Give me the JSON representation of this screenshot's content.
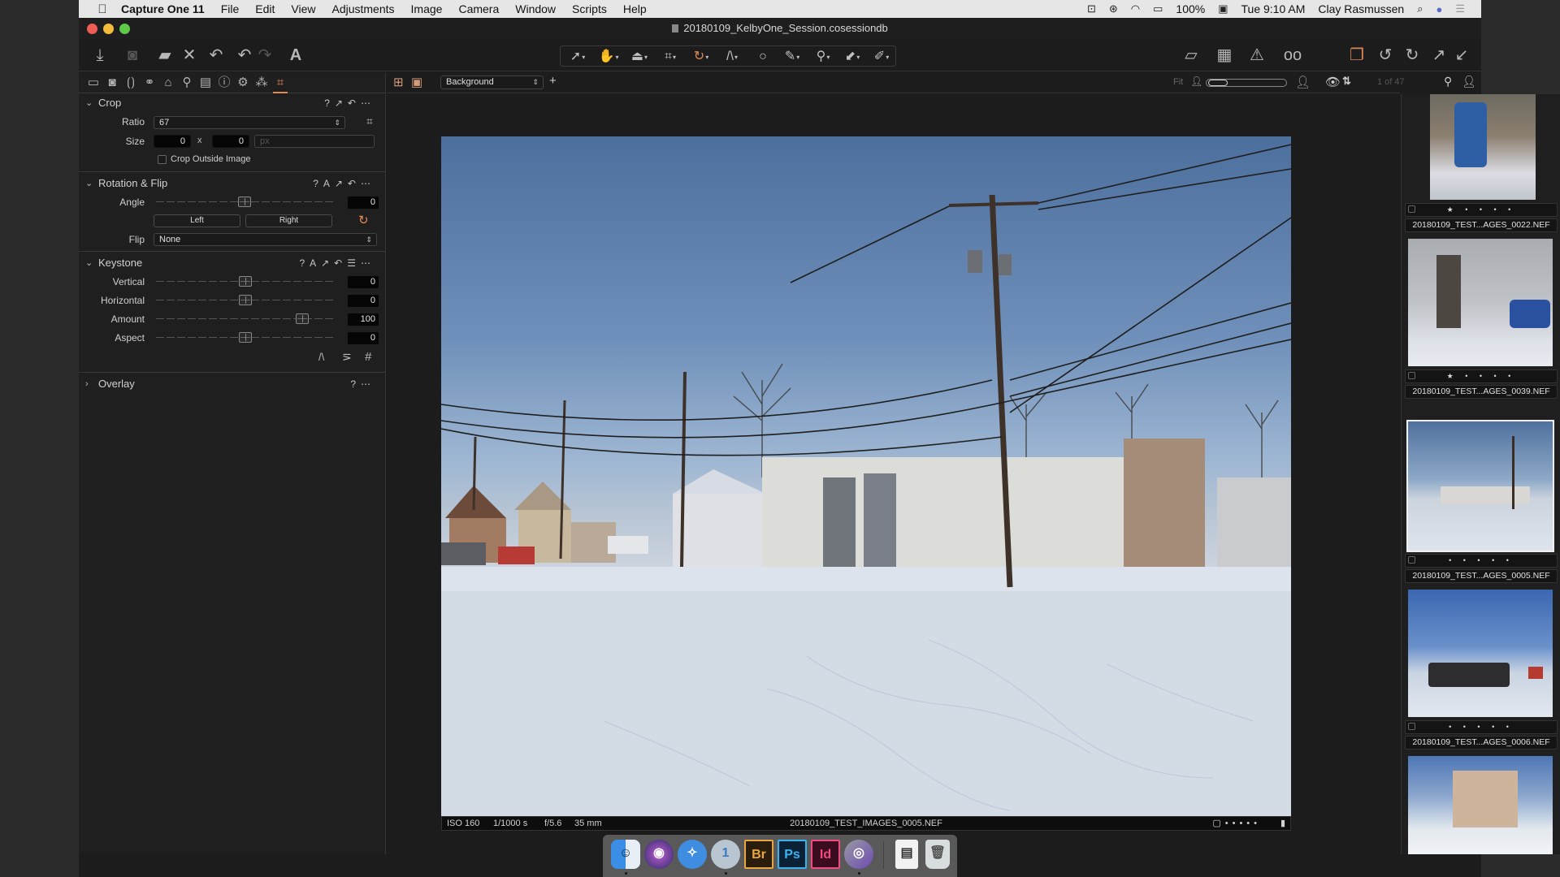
{
  "menubar": {
    "app_name": "Capture One 11",
    "items": [
      "File",
      "Edit",
      "View",
      "Adjustments",
      "Image",
      "Camera",
      "Window",
      "Scripts",
      "Help"
    ],
    "battery": "100%",
    "clock": "Tue 9:10 AM",
    "user": "Clay Rasmussen"
  },
  "window": {
    "title": "20180109_KelbyOne_Session.cosessiondb"
  },
  "toolbar": {
    "left_icons": [
      "import-icon",
      "camera-icon",
      "open-folder-icon",
      "delete-icon",
      "undo-history-icon",
      "undo-icon",
      "redo-icon",
      "text-tool-icon"
    ],
    "cursor_tools": [
      "select-arrow-icon",
      "pan-hand-icon",
      "loupe-icon",
      "crop-icon",
      "rotate-icon",
      "keystone-icon",
      "circle-mask-icon",
      "brush-icon",
      "color-picker-icon",
      "copy-apply-icon",
      "annotation-pen-icon"
    ],
    "right_icons": [
      "edit-overlay-icon",
      "grid-icon",
      "exposure-warning-icon",
      "proof-glasses-icon",
      "multiple-variants-icon",
      "rotate-left-icon",
      "rotate-right-icon",
      "copy-adjustments-icon",
      "apply-adjustments-icon"
    ]
  },
  "left_panel": {
    "tool_tabs": [
      "library-tab",
      "capture-tab",
      "lens-tab",
      "color-tab",
      "exposure-tab",
      "details-tab",
      "local-adjustments-tab",
      "metadata-tab",
      "adjustments-tab",
      "styles-tab",
      "crop-tab"
    ],
    "active_tab": "crop-tab",
    "crop": {
      "title": "Crop",
      "ratio_label": "Ratio",
      "ratio_value": "67",
      "size_label": "Size",
      "size_w": "0",
      "size_x": "x",
      "size_h": "0",
      "size_unit": "px",
      "crop_outside_label": "Crop Outside Image",
      "crop_outside_checked": false
    },
    "rotation": {
      "title": "Rotation & Flip",
      "angle_label": "Angle",
      "angle_value": "0",
      "left_label": "Left",
      "right_label": "Right",
      "flip_label": "Flip",
      "flip_value": "None"
    },
    "keystone": {
      "title": "Keystone",
      "sliders": [
        {
          "label": "Vertical",
          "value": "0",
          "fraction": 0.5
        },
        {
          "label": "Horizontal",
          "value": "0",
          "fraction": 0.5
        },
        {
          "label": "Amount",
          "value": "100",
          "fraction": 0.82
        },
        {
          "label": "Aspect",
          "value": "0",
          "fraction": 0.5
        }
      ]
    },
    "overlay": {
      "title": "Overlay"
    }
  },
  "viewer": {
    "style_select": "Background",
    "fit_label": "Fit",
    "counter": "1 of 47",
    "photo_info": {
      "iso": "ISO 160",
      "shutter": "1/1000 s",
      "aperture": "f/5.6",
      "focal": "35 mm",
      "filename": "20180109_TEST_IMAGES_0005.NEF"
    }
  },
  "browser": {
    "items": [
      {
        "name": "20180109_TEST...AGES_0022.NEF",
        "stars": "★ • • • •",
        "selected": false
      },
      {
        "name": "20180109_TEST...AGES_0039.NEF",
        "stars": "★ • • • •",
        "selected": false
      },
      {
        "name": "20180109_TEST...AGES_0005.NEF",
        "stars": "• • • • •",
        "selected": true
      },
      {
        "name": "20180109_TEST...AGES_0006.NEF",
        "stars": "• • • • •",
        "selected": false
      }
    ]
  },
  "dock": {
    "apps": [
      {
        "name": "Finder",
        "glyph": "☺"
      },
      {
        "name": "Siri",
        "glyph": "◉"
      },
      {
        "name": "Safari",
        "glyph": "✧"
      },
      {
        "name": "Capture One",
        "glyph": "1"
      },
      {
        "name": "Bridge",
        "glyph": "Br"
      },
      {
        "name": "Photoshop",
        "glyph": "Ps"
      },
      {
        "name": "InDesign",
        "glyph": "Id"
      },
      {
        "name": "Photos Slideshow",
        "glyph": "◎"
      },
      {
        "name": "Document",
        "glyph": "▤"
      },
      {
        "name": "Trash",
        "glyph": "🗑"
      }
    ]
  },
  "colors": {
    "accent": "#e08a55",
    "panel_bg": "#1f1f1f",
    "menubar_bg": "#e6e6e6"
  }
}
